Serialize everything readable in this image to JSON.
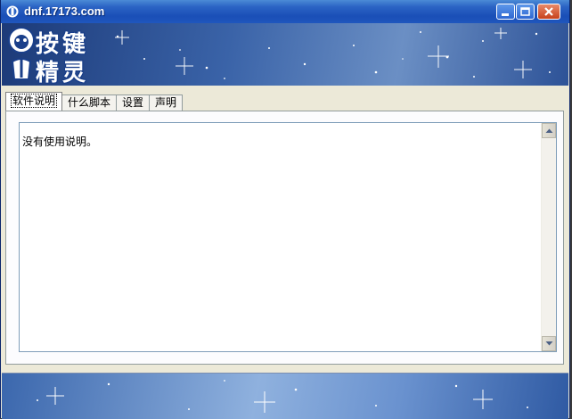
{
  "window": {
    "title": "dnf.17173.com",
    "icon": "app-globe-icon"
  },
  "controls": {
    "minimize": "minimize-icon",
    "maximize": "maximize-icon",
    "close": "close-icon"
  },
  "banner": {
    "logo_chars": [
      "按",
      "键",
      "精",
      "灵"
    ]
  },
  "tabs": [
    {
      "label": "软件说明",
      "active": true
    },
    {
      "label": "什么脚本",
      "active": false
    },
    {
      "label": "设置",
      "active": false
    },
    {
      "label": "声明",
      "active": false
    }
  ],
  "content": {
    "text": "没有使用说明。"
  },
  "colors": {
    "titlebar": "#1f56bd",
    "banner": "#2d5297",
    "close_button": "#c7421c"
  }
}
